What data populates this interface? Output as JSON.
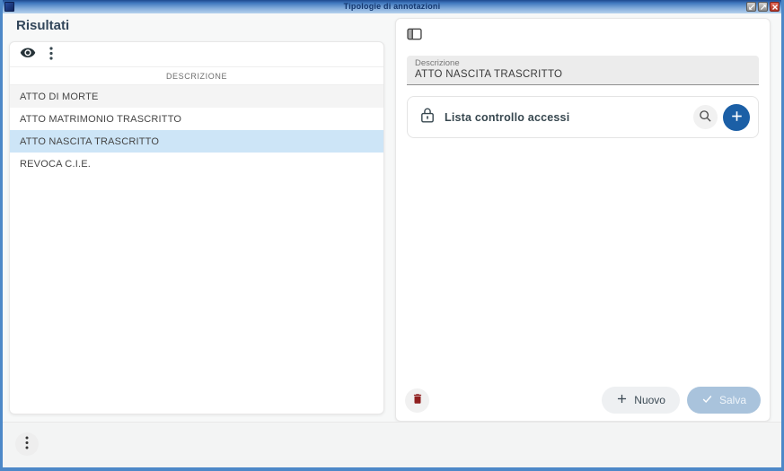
{
  "window": {
    "title": "Tipologie di annotazioni",
    "controls": [
      "restore-down",
      "maximize",
      "close"
    ]
  },
  "left_panel": {
    "heading": "Risultati",
    "toolbar_icons": [
      "visibility-eye",
      "kebab-menu"
    ],
    "table": {
      "header": "DESCRIZIONE",
      "rows": [
        "ATTO DI MORTE",
        "ATTO MATRIMONIO TRASCRITTO",
        "ATTO NASCITA TRASCRITTO",
        "REVOCA C.I.E."
      ],
      "selected_index": 2,
      "selected_row": "ATTO NASCITA TRASCRITTO"
    }
  },
  "right_panel": {
    "toolbar_icons": [
      "split-view"
    ],
    "descrizione_field": {
      "label": "Descrizione",
      "value": "ATTO NASCITA TRASCRITTO"
    },
    "acl_section": {
      "label": "Lista controllo accessi",
      "icons": [
        "lock",
        "search",
        "add-plus"
      ]
    },
    "actions": {
      "delete_icon": "trash",
      "nuovo": "Nuovo",
      "salva": "Salva",
      "salva_enabled": false
    }
  },
  "footer": {
    "icons": [
      "kebab-menu"
    ]
  },
  "colors": {
    "window_border": "#4d88c8",
    "titlebar_text": "#12366e",
    "accent_blue": "#1b5fa6",
    "selected_row_bg": "#cde5f7",
    "striped_row_bg": "#f4f4f4",
    "danger_red": "#8f1f1f",
    "salva_disabled_bg": "#a9c3dc",
    "heading_text": "#33475b"
  }
}
